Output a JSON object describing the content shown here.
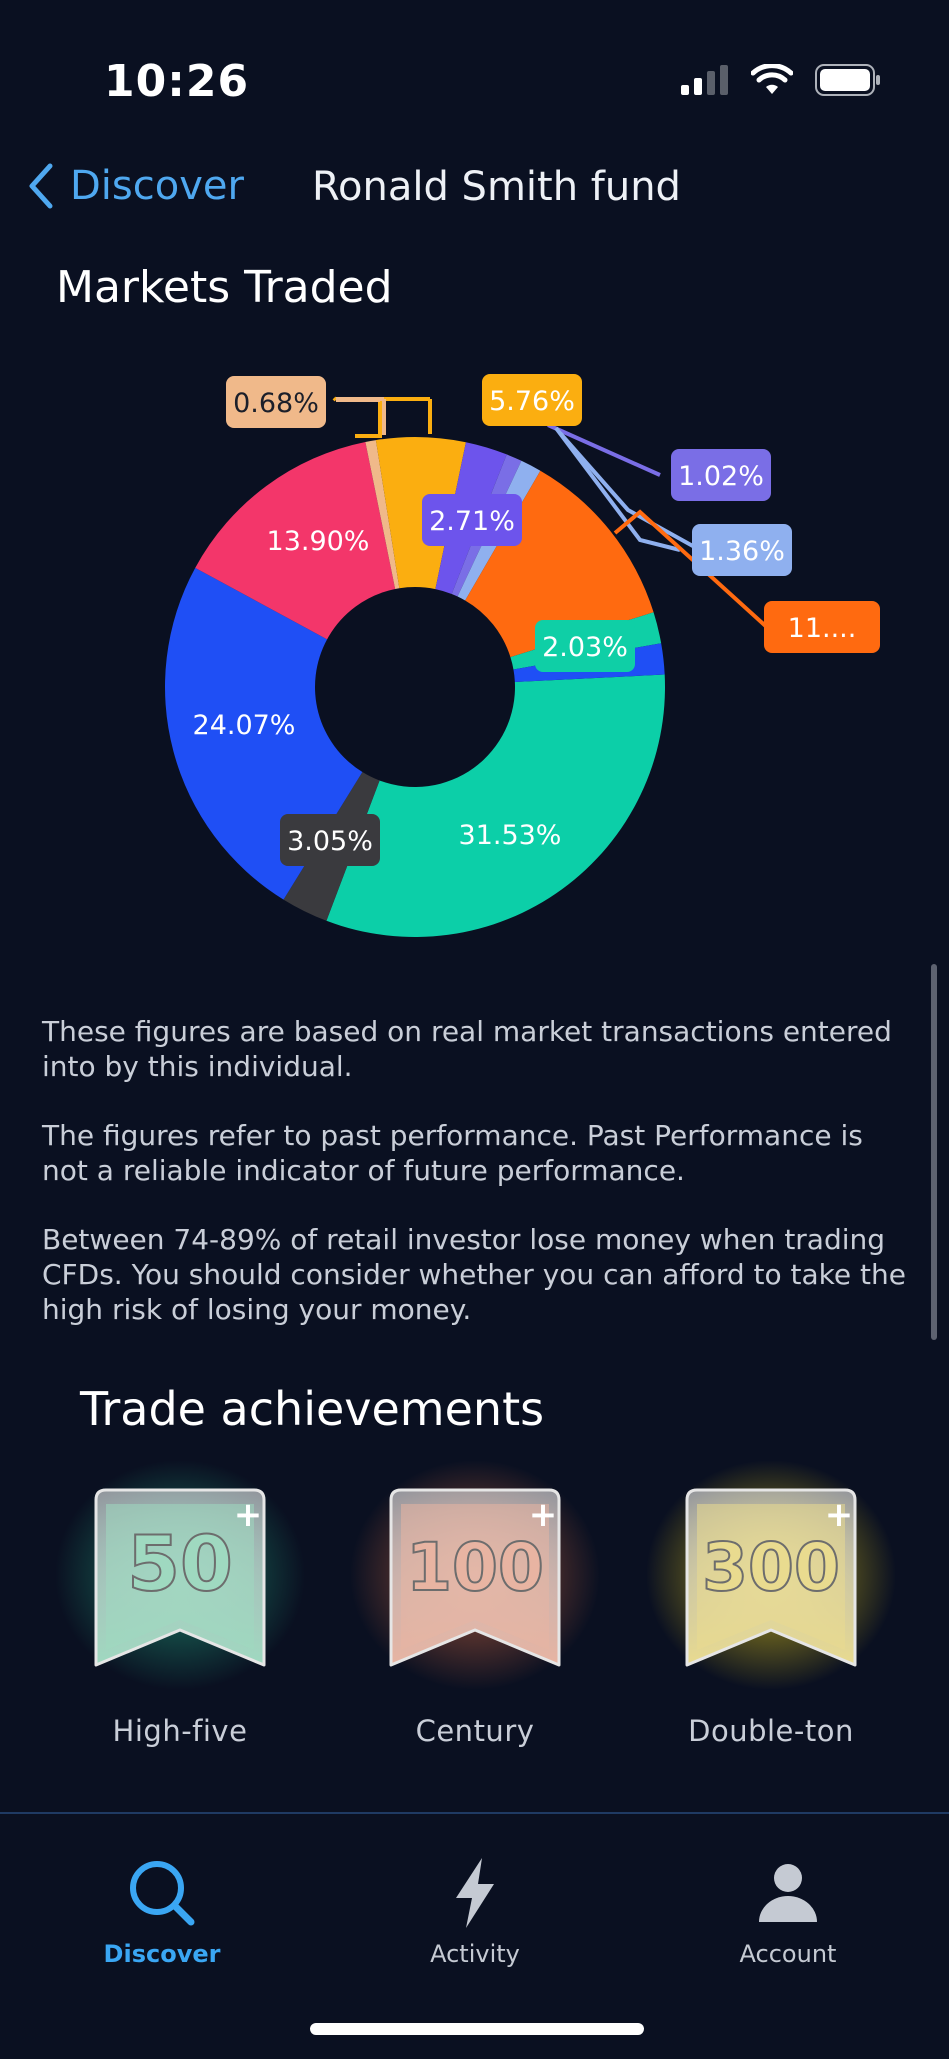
{
  "status_bar": {
    "time": "10:26"
  },
  "nav": {
    "back_label": "Discover",
    "title": "Ronald Smith fund"
  },
  "markets": {
    "title": "Markets Traded",
    "chart_data": {
      "type": "pie",
      "slices": [
        {
          "label": "31.53%",
          "value": 31.53,
          "color": "#0ccfa8"
        },
        {
          "label": "3.05%",
          "value": 3.05,
          "color": "#3a3a3e"
        },
        {
          "label": "24.07%",
          "value": 24.07,
          "color": "#1f4ff5"
        },
        {
          "label": "13.90%",
          "value": 13.9,
          "color": "#f3366a"
        },
        {
          "label": "0.68%",
          "value": 0.68,
          "color": "#f0b98a"
        },
        {
          "label": "5.76%",
          "value": 5.76,
          "color": "#fbae10"
        },
        {
          "label": "2.71%",
          "value": 2.71,
          "color": "#6d54ec"
        },
        {
          "label": "1.02%",
          "value": 1.02,
          "color": "#7a6ee6"
        },
        {
          "label": "1.36%",
          "value": 1.36,
          "color": "#8fb0ef"
        },
        {
          "label": "11....",
          "value": 11.8,
          "color": "#ff6a10"
        },
        {
          "label": "2.03%",
          "value": 2.03,
          "color": "#0fcfa6"
        },
        {
          "label": "",
          "value": 2.0,
          "color": "#1f4ff5"
        }
      ]
    }
  },
  "disclaimer": {
    "p1": "These figures are based on real market transactions entered into by this individual.",
    "p2": "The figures refer to past performance. Past Performance is not a reliable indicator of future performance.",
    "p3": "Between 74-89% of retail investor lose money when trading CFDs. You should consider whether you can afford to take the high risk of losing your money."
  },
  "achievements": {
    "title": "Trade achievements",
    "badges": [
      {
        "number": "50",
        "name": "High-five",
        "color": "#9fd9c0",
        "glow": "#1f8a6e"
      },
      {
        "number": "100",
        "name": "Century",
        "color": "#e8b4a2",
        "glow": "#b05a3c"
      },
      {
        "number": "300",
        "name": "Double-ton",
        "color": "#e9db8f",
        "glow": "#c9b31c"
      }
    ]
  },
  "tabs": [
    {
      "label": "Discover",
      "icon": "search-icon"
    },
    {
      "label": "Activity",
      "icon": "lightning-icon"
    },
    {
      "label": "Account",
      "icon": "person-icon"
    }
  ]
}
